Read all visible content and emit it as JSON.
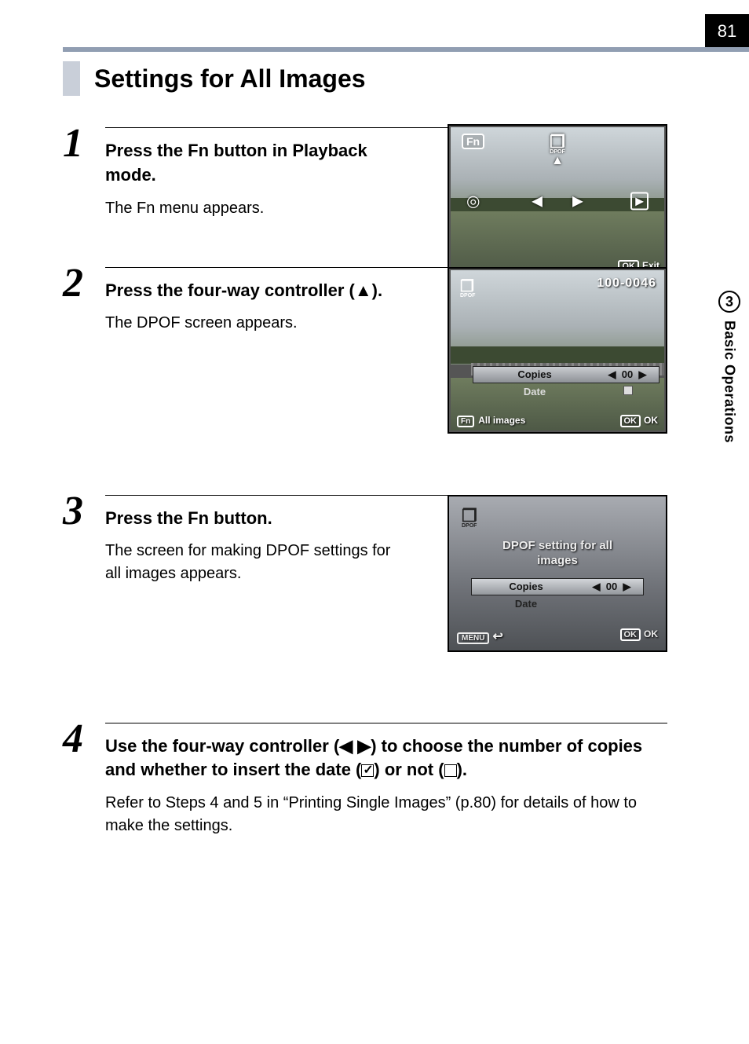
{
  "page_number": "81",
  "side_tab": {
    "number": "3",
    "label": "Basic Operations"
  },
  "section_title": "Settings for All Images",
  "steps": [
    {
      "num": "1",
      "head_before": "Press the ",
      "head_fn": "Fn",
      "head_after": " button in Playback mode.",
      "text": "The Fn menu appears."
    },
    {
      "num": "2",
      "head_before": "Press the four-way controller (",
      "head_symbol": "▲",
      "head_after": ").",
      "text": "The DPOF screen appears."
    },
    {
      "num": "3",
      "head_before": "Press the ",
      "head_fn": "Fn",
      "head_after": " button.",
      "text": "The screen for making DPOF settings for all images appears."
    },
    {
      "num": "4",
      "head_before": "Use the four-way controller (",
      "head_symbol": "◀ ▶",
      "head_mid": ") to choose the number of copies and whether to insert the date (",
      "head_check_on": "☑",
      "head_mid2": ") or not (",
      "head_check_off": "☐",
      "head_after": ").",
      "text": "Refer to Steps 4 and 5 in “Printing Single Images” (p.80) for details of how to make the settings."
    }
  ],
  "lcd1": {
    "fn": "Fn",
    "dpof_glyph": "❐",
    "arrow_up": "▲",
    "arrow_left": "◀",
    "arrow_right": "▶",
    "left_icon": "◎",
    "right_icon": "▶",
    "ok": "OK",
    "exit": "Exit"
  },
  "lcd2": {
    "dpof_glyph": "❐",
    "file_no": "100-0046",
    "copies_label": "Copies",
    "copies_value": "00",
    "arrow_left": "◀",
    "arrow_right": "▶",
    "date_label": "Date",
    "fn": "Fn",
    "all_images": "All images",
    "ok": "OK",
    "ok2": "OK"
  },
  "lcd3": {
    "dpof_glyph": "❐",
    "msg_line1": "DPOF setting for all",
    "msg_line2": "images",
    "copies_label": "Copies",
    "copies_value": "00",
    "arrow_left": "◀",
    "arrow_right": "▶",
    "date_label": "Date",
    "menu": "MENU",
    "back_glyph": "↩",
    "ok": "OK",
    "ok2": "OK"
  }
}
